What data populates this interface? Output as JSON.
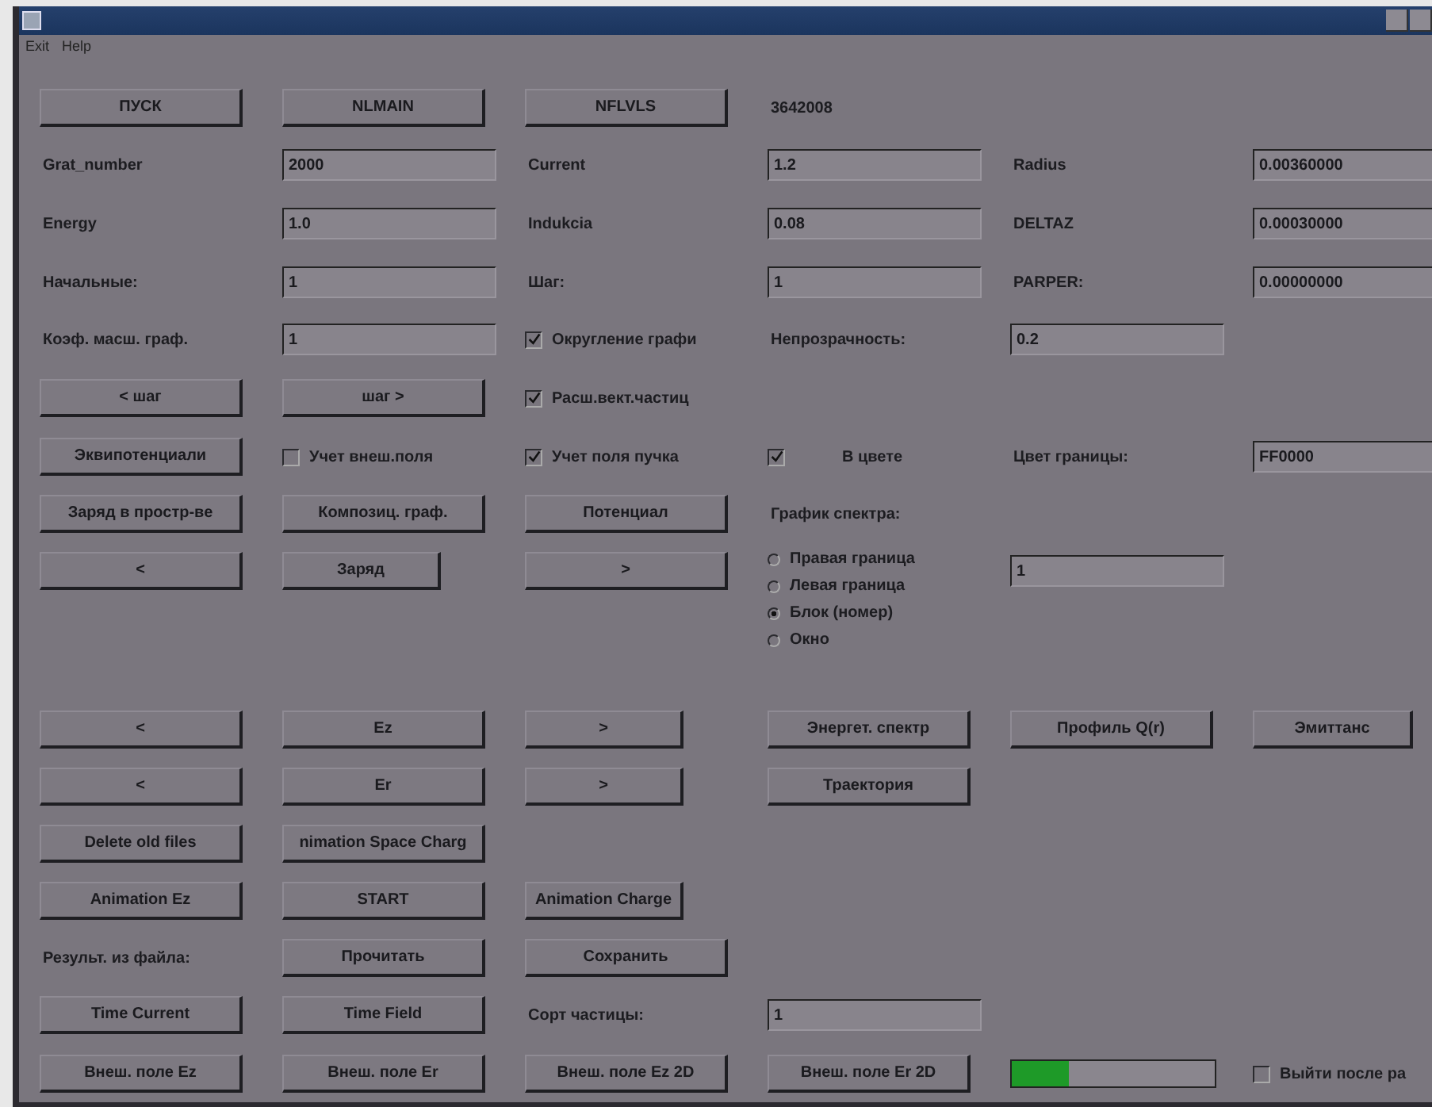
{
  "menu": [
    {
      "label": "Exit"
    },
    {
      "label": "Help"
    }
  ],
  "controls": [
    {
      "kind": "button",
      "label": "ПУСК"
    },
    {
      "kind": "button",
      "label": "NLMAIN"
    },
    {
      "kind": "button",
      "label": "NFLVLS"
    },
    {
      "kind": "label",
      "label": "3642008"
    },
    {
      "kind": "label",
      "label": "Grat_number"
    },
    {
      "kind": "field",
      "value": "2000"
    },
    {
      "kind": "label",
      "label": "Current"
    },
    {
      "kind": "field",
      "value": "1.2"
    },
    {
      "kind": "label",
      "label": "Radius"
    },
    {
      "kind": "field",
      "value": "0.00360000"
    },
    {
      "kind": "label",
      "label": "Energy"
    },
    {
      "kind": "field",
      "value": "1.0"
    },
    {
      "kind": "label",
      "label": "Indukcia"
    },
    {
      "kind": "field",
      "value": "0.08"
    },
    {
      "kind": "label",
      "label": "DELTAZ"
    },
    {
      "kind": "field",
      "value": "0.00030000"
    },
    {
      "kind": "label",
      "label": "Начальные:"
    },
    {
      "kind": "field",
      "value": "1"
    },
    {
      "kind": "label",
      "label": "Шаг:"
    },
    {
      "kind": "field",
      "value": "1"
    },
    {
      "kind": "label",
      "label": "PARPER:"
    },
    {
      "kind": "field",
      "value": "0.00000000"
    },
    {
      "kind": "label",
      "label": "Коэф. масш. граф."
    },
    {
      "kind": "field",
      "value": "1"
    },
    {
      "kind": "checkbox",
      "label": "Округление графи",
      "checked": true
    },
    {
      "kind": "label",
      "label": "Непрозрачность:"
    },
    {
      "kind": "field",
      "value": "0.2"
    },
    {
      "kind": "button",
      "label": "< шаг"
    },
    {
      "kind": "button",
      "label": "шаг >"
    },
    {
      "kind": "checkbox",
      "label": "Расш.вект.частиц",
      "checked": true
    },
    {
      "kind": "button",
      "label": "Эквипотенциали"
    },
    {
      "kind": "checkbox",
      "label": "Учет внеш.поля",
      "checked": false
    },
    {
      "kind": "checkbox",
      "label": "Учет поля пучка",
      "checked": true
    },
    {
      "kind": "checkbox",
      "label": "В цвете",
      "checked": true
    },
    {
      "kind": "label",
      "label": "Цвет границы:"
    },
    {
      "kind": "field",
      "value": "FF0000"
    },
    {
      "kind": "button",
      "label": "Заряд в простр-ве"
    },
    {
      "kind": "button",
      "label": "Композиц. граф."
    },
    {
      "kind": "button",
      "label": "Потенциал"
    },
    {
      "kind": "label",
      "label": "График спектра:"
    },
    {
      "kind": "button",
      "label": "<"
    },
    {
      "kind": "button",
      "label": "Заряд"
    },
    {
      "kind": "button",
      "label": ">"
    },
    {
      "kind": "radio_group",
      "options": [
        {
          "label": "Правая граница",
          "selected": false
        },
        {
          "label": "Левая граница",
          "selected": false
        },
        {
          "label": "Блок (номер)",
          "selected": true
        },
        {
          "label": "Окно",
          "selected": false
        }
      ]
    },
    {
      "kind": "field",
      "value": "1"
    },
    {
      "kind": "button",
      "label": "<"
    },
    {
      "kind": "button",
      "label": "Ez"
    },
    {
      "kind": "button",
      "label": ">"
    },
    {
      "kind": "button",
      "label": "Энергет. спектр"
    },
    {
      "kind": "button",
      "label": "Профиль Q(r)"
    },
    {
      "kind": "button",
      "label": "Эмиттанс"
    },
    {
      "kind": "button",
      "label": "<"
    },
    {
      "kind": "button",
      "label": "Er"
    },
    {
      "kind": "button",
      "label": ">"
    },
    {
      "kind": "button",
      "label": "Траектория"
    },
    {
      "kind": "button",
      "label": "Delete old files"
    },
    {
      "kind": "button",
      "label": "nimation Space Charg"
    },
    {
      "kind": "button",
      "label": "Animation Ez"
    },
    {
      "kind": "button",
      "label": "START"
    },
    {
      "kind": "button",
      "label": "Animation Charge"
    },
    {
      "kind": "label",
      "label": "Результ. из файла:"
    },
    {
      "kind": "button",
      "label": "Прочитать"
    },
    {
      "kind": "button",
      "label": "Сохранить"
    },
    {
      "kind": "button",
      "label": "Time Current"
    },
    {
      "kind": "button",
      "label": "Time Field"
    },
    {
      "kind": "label",
      "label": "Сорт частицы:"
    },
    {
      "kind": "field",
      "value": "1"
    },
    {
      "kind": "button",
      "label": "Внеш. поле Ez"
    },
    {
      "kind": "button",
      "label": "Внеш. поле Er"
    },
    {
      "kind": "button",
      "label": "Внеш. поле Ez 2D"
    },
    {
      "kind": "button",
      "label": "Внеш. поле Er 2D"
    },
    {
      "kind": "progress",
      "level": 0.28
    },
    {
      "kind": "checkbox",
      "label": "Выйти после ра",
      "checked": false
    }
  ]
}
